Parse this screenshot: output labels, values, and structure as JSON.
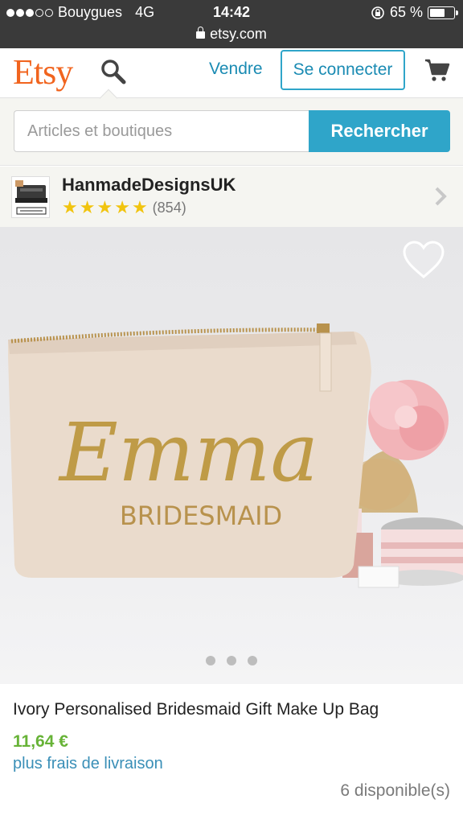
{
  "status_bar": {
    "carrier": "Bouygues",
    "network": "4G",
    "time": "14:42",
    "battery": "65 %",
    "battery_level": 0.65,
    "url": "etsy.com"
  },
  "header": {
    "logo": "Etsy",
    "vendre": "Vendre",
    "connect": "Se connecter"
  },
  "search": {
    "placeholder": "Articles et boutiques",
    "button": "Rechercher"
  },
  "shop": {
    "name": "HanmadeDesignsUK",
    "rating_stars": 5,
    "reviews": "(854)"
  },
  "product": {
    "image_text_name": "Emma",
    "image_text_role": "BRIDESMAID",
    "title": "Ivory Personalised Bridesmaid Gift Make Up Bag",
    "price": "11,64 €",
    "shipping": "plus frais de livraison",
    "stock": "6 disponible(s)"
  },
  "gallery": {
    "pages": 3
  },
  "colors": {
    "brand": "#f1641e",
    "accent": "#2fa5c9",
    "price": "#67b337"
  }
}
